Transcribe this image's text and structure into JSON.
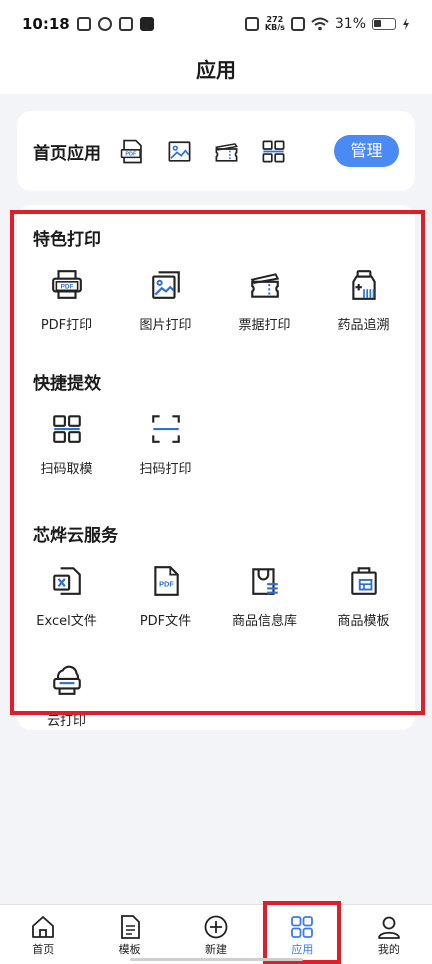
{
  "status_bar": {
    "time": "10:18",
    "network_speed_value": "272",
    "network_speed_unit": "KB/s",
    "battery_percent": "31%",
    "icons": [
      "mail-icon",
      "leaf-icon",
      "crown-icon",
      "tiktok-icon",
      "vibrate-icon",
      "sim-off-icon",
      "wifi-icon",
      "battery-icon",
      "charging-icon"
    ]
  },
  "page": {
    "title": "应用"
  },
  "home_apps": {
    "title": "首页应用",
    "icons": [
      "pdf-icon",
      "image-icon",
      "ticket-icon",
      "scan-template-icon"
    ],
    "manage_label": "管理"
  },
  "sections": [
    {
      "title": "特色打印",
      "items": [
        {
          "label": "PDF打印",
          "icon": "pdf-print-icon"
        },
        {
          "label": "图片打印",
          "icon": "image-print-icon"
        },
        {
          "label": "票据打印",
          "icon": "ticket-print-icon"
        },
        {
          "label": "药品追溯",
          "icon": "medicine-trace-icon"
        }
      ]
    },
    {
      "title": "快捷提效",
      "items": [
        {
          "label": "扫码取模",
          "icon": "scan-template-icon"
        },
        {
          "label": "扫码打印",
          "icon": "scan-print-icon"
        }
      ]
    },
    {
      "title": "芯烨云服务",
      "items": [
        {
          "label": "Excel文件",
          "icon": "excel-file-icon"
        },
        {
          "label": "PDF文件",
          "icon": "pdf-file-icon"
        },
        {
          "label": "商品信息库",
          "icon": "product-library-icon"
        },
        {
          "label": "商品模板",
          "icon": "product-template-icon"
        },
        {
          "label": "云打印",
          "icon": "cloud-print-icon"
        }
      ]
    }
  ],
  "tab_bar": {
    "tabs": [
      {
        "label": "首页",
        "icon": "home-icon"
      },
      {
        "label": "模板",
        "icon": "template-icon"
      },
      {
        "label": "新建",
        "icon": "plus-circle-icon"
      },
      {
        "label": "应用",
        "icon": "apps-icon",
        "active": true
      },
      {
        "label": "我的",
        "icon": "user-icon"
      }
    ]
  },
  "colors": {
    "accent": "#4a8af4",
    "active_tab": "#3a7bf0",
    "highlight": "#e01e2a",
    "background": "#f3f4f8"
  }
}
